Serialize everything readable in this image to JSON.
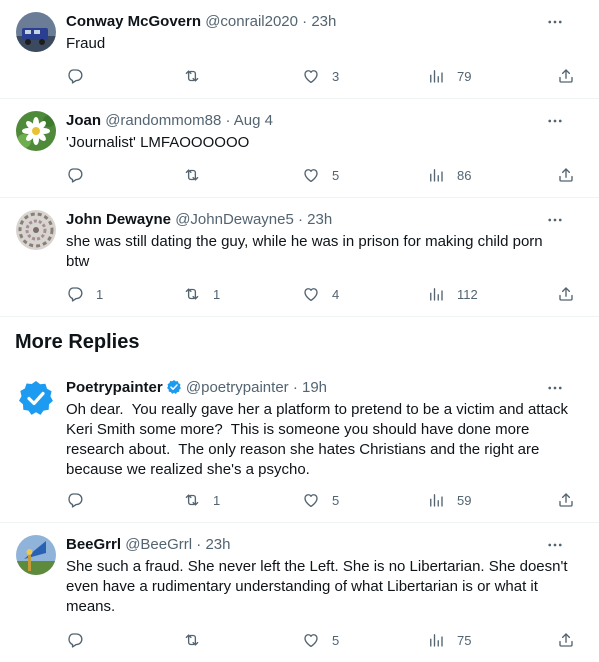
{
  "more_replies_title": "More Replies",
  "tweets": [
    {
      "name": "Conway McGovern",
      "handle": "@conrail2020",
      "time": "· 23h",
      "text": "Fraud",
      "replies": "",
      "retweets": "",
      "likes": "3",
      "views": "79"
    },
    {
      "name": "Joan",
      "handle": "@randommom88",
      "time": "· Aug 4",
      "text": "'Journalist' LMFAOOOOOO",
      "replies": "",
      "retweets": "",
      "likes": "5",
      "views": "86"
    },
    {
      "name": "John Dewayne",
      "handle": "@JohnDewayne5",
      "time": "· 23h",
      "text": "she was still dating the guy, while he was in prison for making child porn btw",
      "replies": "1",
      "retweets": "1",
      "likes": "4",
      "views": "112"
    },
    {
      "name": "Poetrypainter",
      "handle": "@poetrypainter",
      "time": "· 19h",
      "text": "Oh dear.  You really gave her a platform to pretend to be a victim and attack Keri Smith some more?  This is someone you should have done more research about.  The only reason she hates Christians and the right are because we realized she's a psycho.",
      "replies": "",
      "retweets": "1",
      "likes": "5",
      "views": "59"
    },
    {
      "name": "BeeGrrl",
      "handle": "@BeeGrrl",
      "time": "· 23h",
      "text": "She such a fraud. She never left the Left. She is no Libertarian. She doesn't even have a rudimentary understanding of what Libertarian is or what it means.",
      "replies": "",
      "retweets": "",
      "likes": "5",
      "views": "75"
    }
  ],
  "colors": {
    "text": "#0f1419",
    "secondary": "#536471",
    "divider": "#eff3f4",
    "verified": "#1d9bf0"
  }
}
